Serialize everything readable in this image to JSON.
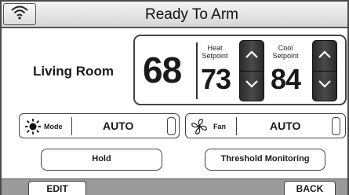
{
  "header": {
    "title": "Ready To Arm",
    "status_icon": "wifi-icon"
  },
  "room": {
    "name": "Living Room"
  },
  "thermostat": {
    "current_temp": "68",
    "heat": {
      "label_line1": "Heat",
      "label_line2": "Setpoint",
      "value": "73"
    },
    "cool": {
      "label_line1": "Cool",
      "label_line2": "Setpoint",
      "value": "84"
    }
  },
  "mode": {
    "label": "Mode",
    "value": "AUTO",
    "icon": "sun-icon"
  },
  "fan": {
    "label": "Fan",
    "value": "AUTO",
    "icon": "fan-icon"
  },
  "buttons": {
    "hold": "Hold",
    "threshold": "Threshold Monitoring"
  },
  "footer": {
    "edit": "EDIT",
    "back": "BACK"
  },
  "colors": {
    "spinner": "#333333",
    "footer_bar": "#9a9a9a",
    "header": "#e0e0e0"
  }
}
